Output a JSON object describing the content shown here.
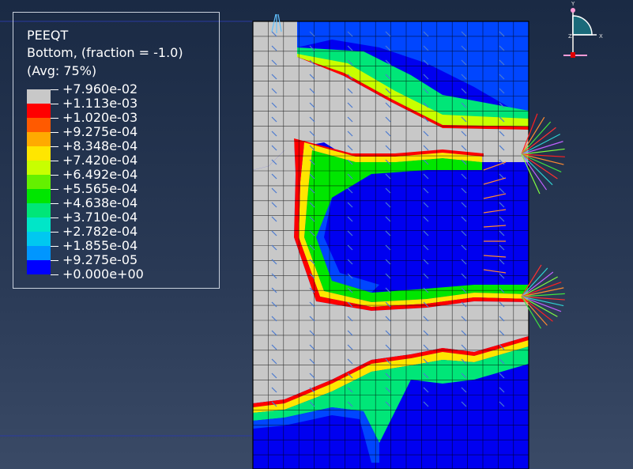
{
  "legend": {
    "title": "PEEQT",
    "subtitle": "Bottom, (fraction = -1.0)",
    "averaging": "(Avg: 75%)",
    "entries": [
      {
        "value": "+7.960e-02",
        "color": "#c8c8c8"
      },
      {
        "value": "+1.113e-03",
        "color": "#ff0000"
      },
      {
        "value": "+1.020e-03",
        "color": "#ff5a00"
      },
      {
        "value": "+9.275e-04",
        "color": "#ffaa00"
      },
      {
        "value": "+8.348e-04",
        "color": "#ffe600"
      },
      {
        "value": "+7.420e-04",
        "color": "#c8ff00"
      },
      {
        "value": "+6.492e-04",
        "color": "#64f000"
      },
      {
        "value": "+5.565e-04",
        "color": "#00e600"
      },
      {
        "value": "+4.638e-04",
        "color": "#00e678"
      },
      {
        "value": "+3.710e-04",
        "color": "#00e6c8"
      },
      {
        "value": "+2.782e-04",
        "color": "#00c8f0"
      },
      {
        "value": "+1.855e-04",
        "color": "#0096ff"
      },
      {
        "value": "+9.275e-05",
        "color": "#0046ff"
      },
      {
        "value": "+0.000e+00",
        "color": null
      }
    ]
  },
  "triad": {
    "y_label": "Y",
    "x_label": "X",
    "z_label": "Z"
  },
  "colors": {
    "background_top": "#1a2a44",
    "background_bottom": "#3a4a66",
    "mesh_lines": "#000000",
    "min_contour": "#0000ff",
    "legend_border": "#c8d0dc",
    "legend_text": "#ffffff"
  }
}
